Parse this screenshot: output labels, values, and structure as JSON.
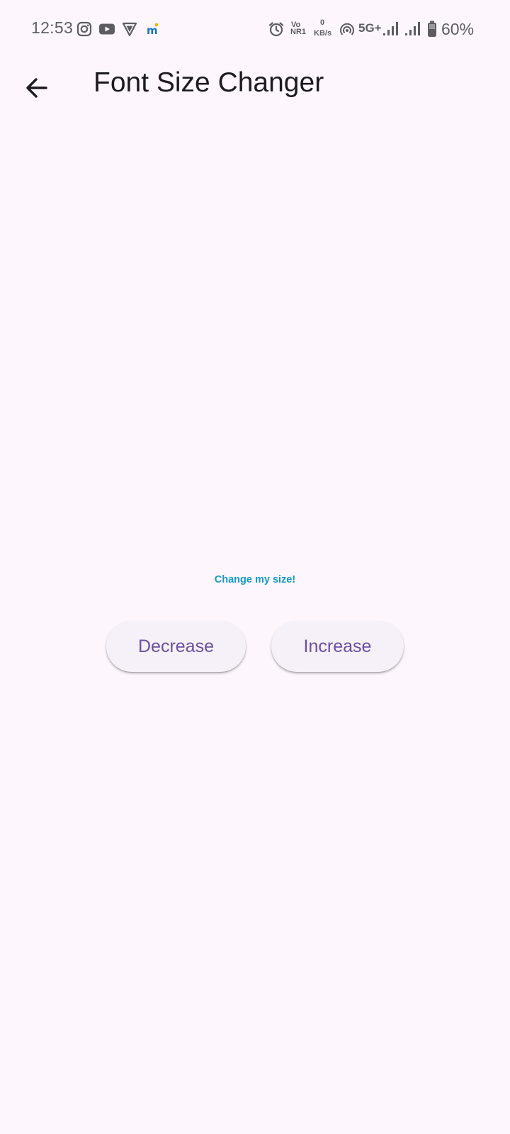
{
  "status_bar": {
    "time": "12:53",
    "notification_icons": [
      "instagram-icon",
      "youtube-icon",
      "shield-app-icon",
      "m-app-icon"
    ],
    "volte_top": "Vo",
    "volte_bottom": "NR1",
    "net_speed_value": "0",
    "net_speed_unit": "KB/s",
    "network_type": "5G+",
    "battery": "60%"
  },
  "app_bar": {
    "back_icon": "arrow-back-icon",
    "title": "Font Size Changer"
  },
  "content": {
    "sample_text": "Change my size!",
    "decrease_label": "Decrease",
    "increase_label": "Increase"
  },
  "colors": {
    "background": "#fdf7fd",
    "sample_text": "#1499c6",
    "button_text": "#6a4fa0",
    "button_bg": "#f6f1f8"
  }
}
